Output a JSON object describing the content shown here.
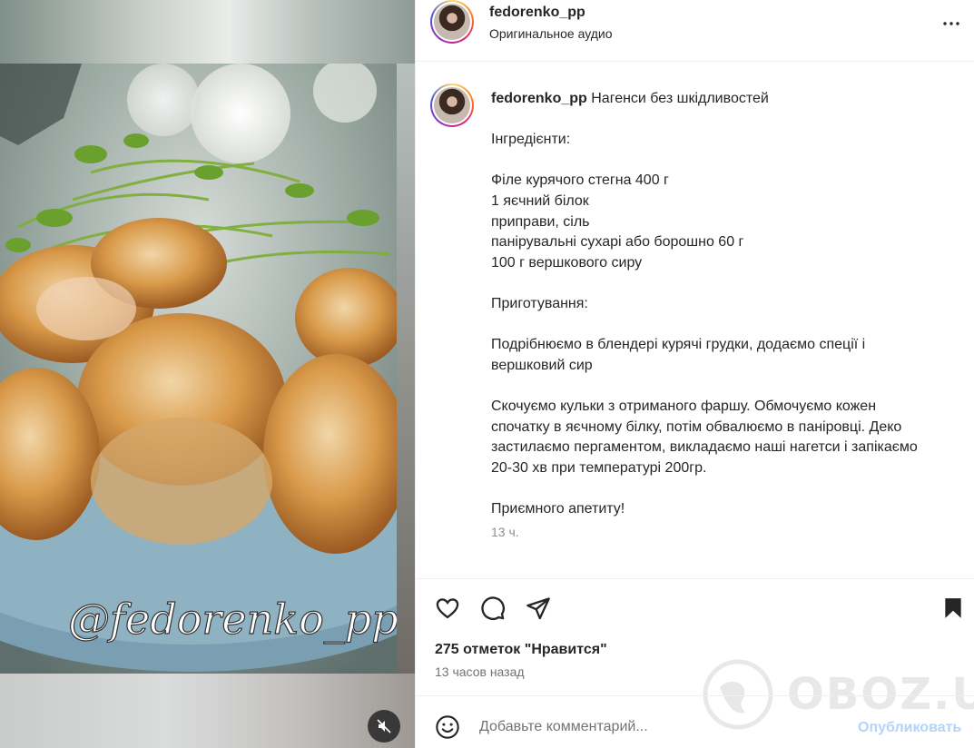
{
  "media": {
    "watermark_handle": "@fedorenko_pp",
    "mute_icon": "speaker-muted-icon"
  },
  "header": {
    "username": "fedorenko_pp",
    "audio": "Оригинальное аудио",
    "more_icon": "more-horizontal-icon"
  },
  "caption": {
    "username": "fedorenko_pp",
    "title": "Нагенси без шкідливостей",
    "lines": [
      "Інгредієнти:",
      "",
      "Філе курячого стегна 400 г",
      "1 яєчний білок",
      "приправи, сіль",
      "панірувальні сухарі або борошно 60 г",
      "100 г вершкового сиру",
      "",
      "Приготування:",
      "",
      "Подрібнюємо в блендері курячі грудки, додаємо спеції і",
      "вершковий сир",
      "",
      "Скочуємо кульки з отриманого фаршу. Обмочуємо кожен",
      "спочатку в яєчному білку, потім обвалюємо в паніровці. Деко",
      "застилаємо пергаментом, викладаємо наші нагетси і запікаємо",
      "20-30 хв при температурі 200гр.",
      "",
      "Приємного апетиту!"
    ],
    "age": "13 ч."
  },
  "actions": {
    "like_icon": "heart-icon",
    "comment_icon": "comment-icon",
    "share_icon": "share-icon",
    "save_icon": "bookmark-filled-icon"
  },
  "likes": "275 отметок \"Нравится\"",
  "timestamp": "13 часов назад",
  "comment": {
    "placeholder": "Добавьте комментарий...",
    "publish_label": "Опубликовать",
    "emoji_icon": "emoji-icon"
  },
  "watermark_site": {
    "text": "OBOZ.UA"
  },
  "colors": {
    "accent_disabled": "#b3d3f9",
    "text": "#262626",
    "muted": "#737373",
    "divider": "#efefef"
  }
}
